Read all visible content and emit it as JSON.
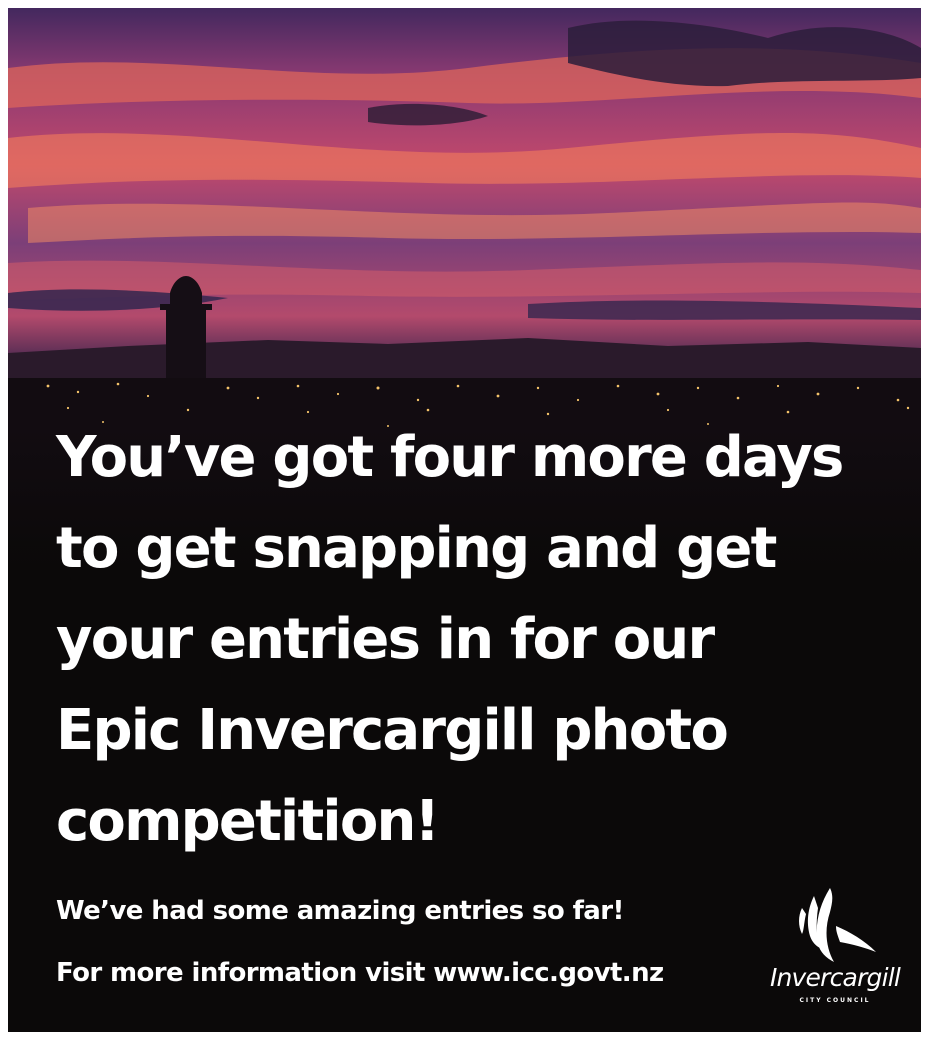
{
  "headline": {
    "line1": "You’ve got four more days",
    "line2": "to get snapping and get",
    "line3": "your entries in for our",
    "line4": "Epic Invercargill photo",
    "line5": "competition!"
  },
  "subtext": {
    "line1": "We’ve had some amazing entries so far!",
    "line2": "For more information visit www.icc.govt.nz"
  },
  "logo": {
    "wordmark": "Invercargill",
    "subtitle": "CITY COUNCIL",
    "icon": "swoosh-logo-icon"
  },
  "colors": {
    "background": "#0b0909",
    "text": "#ffffff",
    "sky_magenta": "#b83a74",
    "sky_orange": "#e46a4e",
    "sky_purple": "#4a2f66"
  }
}
